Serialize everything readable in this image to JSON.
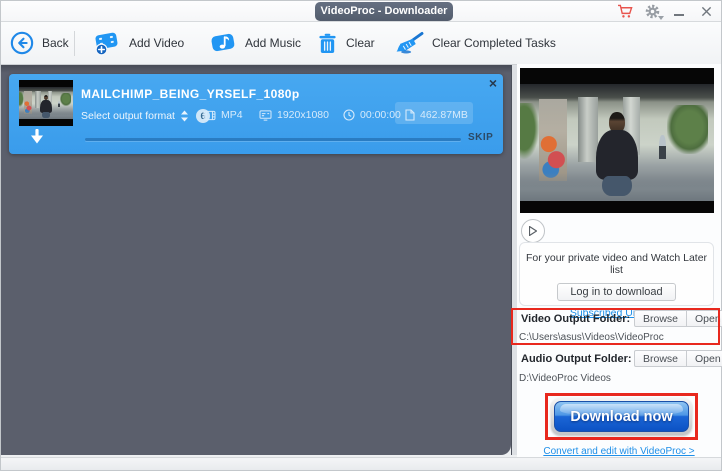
{
  "titlebar": {
    "title": "VideoProc - Downloader"
  },
  "toolbar": {
    "back": "Back",
    "add_video": "Add Video",
    "add_music": "Add Music",
    "clear": "Clear",
    "clear_completed": "Clear Completed Tasks"
  },
  "download_item": {
    "title": "MAILCHIMP_BEING_YRSELF_1080p",
    "format_label": "Select output format",
    "format_count": "6",
    "media_info": [
      {
        "icon": "film-icon",
        "value": "MP4"
      },
      {
        "icon": "resolution-icon",
        "value": "1920x1080"
      },
      {
        "icon": "clock-icon",
        "value": "00:00:00"
      },
      {
        "icon": "file-icon",
        "value": "462.87MB"
      }
    ],
    "skip_label": "SKIP",
    "close_glyph": "×"
  },
  "right_panel": {
    "login_message": "For your private video and Watch Later list",
    "login_button": "Log in to download",
    "subscribed_link": "Subscribed Urls List",
    "video_output": {
      "label": "Video Output Folder:",
      "browse": "Browse",
      "open": "Open",
      "path": "C:\\Users\\asus\\Videos\\VideoProc"
    },
    "audio_output": {
      "label": "Audio Output Folder:",
      "browse": "Browse",
      "open": "Open",
      "path": "D:\\VideoProc Videos"
    },
    "download_button": "Download now",
    "convert_link": "Convert and edit with VideoProc >"
  },
  "glyphs": {
    "minimize": "–"
  },
  "colors": {
    "accent_blue": "#2196f3",
    "card_blue": "#3fa2ef",
    "panel_dark": "#5b5f6c",
    "highlight_red": "#e8281e",
    "link_blue": "#1e8fe8"
  }
}
